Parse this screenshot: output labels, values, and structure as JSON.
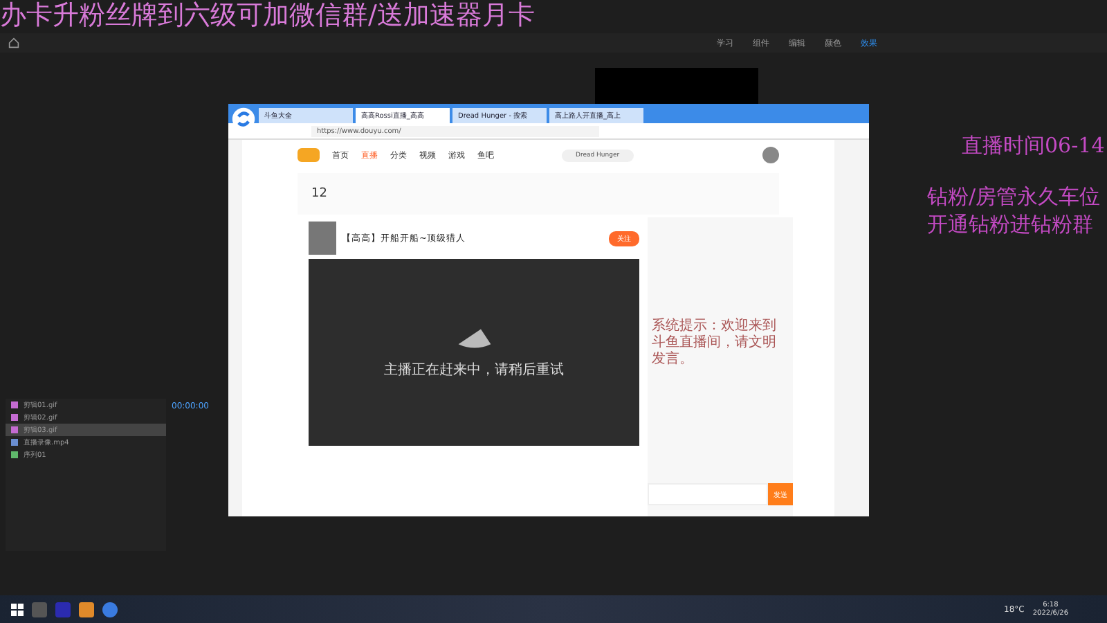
{
  "overlay": {
    "banner": "办卡升粉丝牌到六级可加微信群/送加速器月卡",
    "live_time": "直播时间06-14",
    "notice_lines": [
      "钻粉/房管永久车位",
      "开通钻粉进钻粉群"
    ]
  },
  "editor": {
    "workspaces": [
      {
        "label": "学习",
        "selected": false
      },
      {
        "label": "组件",
        "selected": false
      },
      {
        "label": "编辑",
        "selected": false
      },
      {
        "label": "颜色",
        "selected": false
      },
      {
        "label": "效果",
        "selected": true
      }
    ],
    "project_files": [
      {
        "name": "剪辑01.gif",
        "color": "#c46bd1",
        "selected": false
      },
      {
        "name": "剪辑02.gif",
        "color": "#c46bd1",
        "selected": false
      },
      {
        "name": "剪辑03.gif",
        "color": "#c46bd1",
        "selected": true
      },
      {
        "name": "直播录像.mp4",
        "color": "#6b8fd1",
        "selected": false
      },
      {
        "name": "序列01",
        "color": "#5fb86b",
        "selected": false
      }
    ],
    "timecode": "00:00:00"
  },
  "browser": {
    "tabs": [
      {
        "label": "斗鱼大全",
        "selected": false
      },
      {
        "label": "高高Rossi直播_高高",
        "selected": true
      },
      {
        "label": "Dread Hunger - 搜索",
        "selected": false
      },
      {
        "label": "高上路人开直播_高上",
        "selected": false
      }
    ],
    "url": "https://www.douyu.com/",
    "nav": [
      {
        "label": "首页",
        "selected": false
      },
      {
        "label": "直播",
        "selected": true
      },
      {
        "label": "分类",
        "selected": false
      },
      {
        "label": "视频",
        "selected": false
      },
      {
        "label": "游戏",
        "selected": false
      },
      {
        "label": "鱼吧",
        "selected": false
      }
    ],
    "search": "Dread Hunger",
    "level": "12",
    "room_title": "【高高】开船开船~顶级猎人",
    "follow": "关注",
    "player_message": "主播正在赶来中，请稍后重试",
    "chat_notice": "系统提示：欢迎来到斗鱼直播间，请文明发言。",
    "send": "发送"
  },
  "taskbar": {
    "weather": "18°C",
    "time": "6:18",
    "date": "2022/6/26"
  }
}
